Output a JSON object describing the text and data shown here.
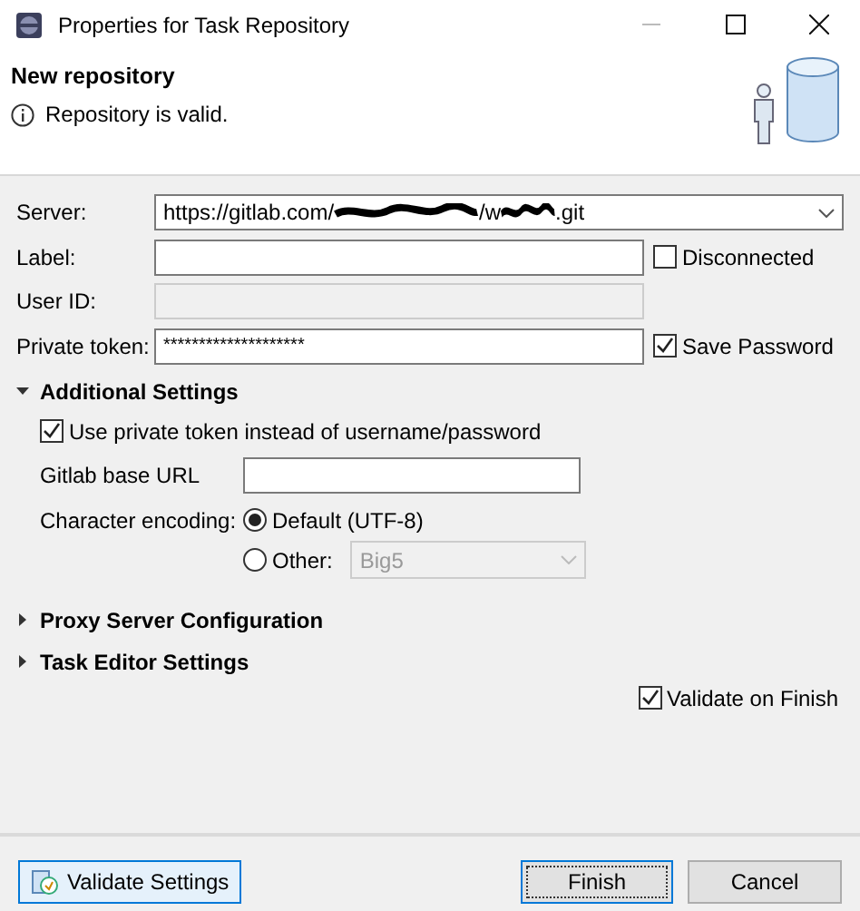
{
  "window": {
    "title": "Properties for Task Repository"
  },
  "header": {
    "title": "New repository",
    "message": "Repository is valid."
  },
  "rows": [
    {
      "kind": "combo",
      "label": "Server:",
      "value_parts": [
        "https://gitlab.com/",
        "/w",
        ".git"
      ]
    },
    {
      "kind": "text",
      "label": "Label:",
      "disabled": false,
      "check": {
        "label": "Disconnected",
        "checked": false
      }
    },
    {
      "kind": "text",
      "label": "User ID:",
      "disabled": true
    },
    {
      "kind": "text",
      "label": "Private token:",
      "disabled": false,
      "value": "********************",
      "check": {
        "label": "Save Password",
        "checked": true
      }
    }
  ],
  "sections": [
    {
      "title": "Additional Settings",
      "expanded": true,
      "use_token": {
        "label": "Use private token instead of username/password",
        "checked": true
      },
      "base_url": {
        "label": "Gitlab base URL"
      },
      "encoding": {
        "label": "Character encoding:",
        "options": [
          {
            "label": "Default (UTF-8)",
            "selected": true
          },
          {
            "label": "Other:",
            "selected": false,
            "value": "Big5"
          }
        ]
      }
    },
    {
      "title": "Proxy Server Configuration",
      "expanded": false
    },
    {
      "title": "Task Editor Settings",
      "expanded": false
    }
  ],
  "validate_on_finish": {
    "label": "Validate on Finish",
    "checked": true
  },
  "buttons": [
    {
      "kind": "validate",
      "label": "Validate Settings"
    },
    {
      "kind": "default",
      "label": "Finish"
    },
    {
      "kind": "normal",
      "label": "Cancel"
    }
  ]
}
